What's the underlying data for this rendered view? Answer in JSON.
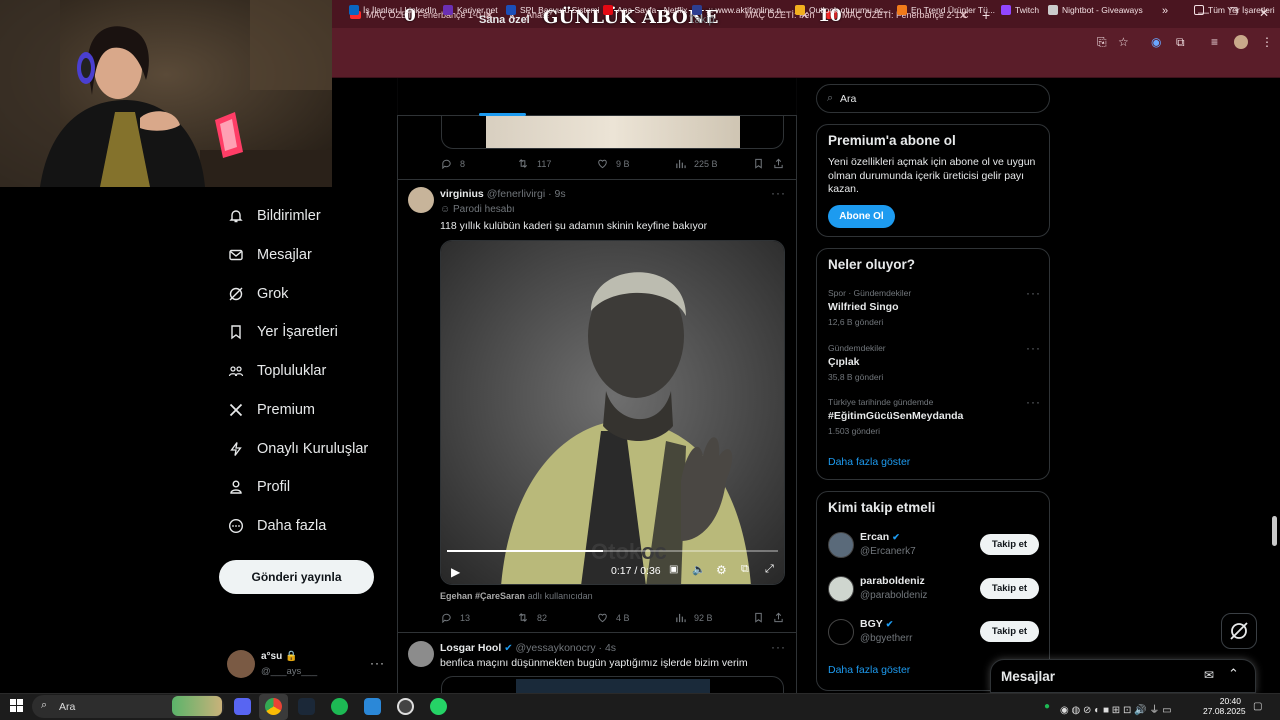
{
  "browser": {
    "tabs": [
      {
        "title": "MAÇ ÖZETİ Fenerbahçe 1-0 In",
        "color": "#ff2a2a"
      },
      {
        "title": "Anasa",
        "color": "#000000"
      },
      {
        "title": "MAÇ ÖZETİ: Fenerbahçe 3-0 M",
        "color": "#ff2a2a"
      },
      {
        "title": "MAÇ ÖZETİ: Fenerbahçe 2-1 C",
        "color": "#ff2a2a"
      }
    ],
    "new_tab": "+",
    "overlay": {
      "left_count": "0",
      "title": "GÜNLÜK ABONE",
      "right_count": "10"
    },
    "bookmarks": [
      {
        "label": "İş İlanları | LinkedIn",
        "color": "#0a66c2"
      },
      {
        "label": "Kariyer.net",
        "color": "#6b2fb3"
      },
      {
        "label": "SPL Başvuru Sistemi",
        "color": "#1b4fb8"
      },
      {
        "label": "Ana Sayfa - Netflix",
        "color": "#e50914"
      },
      {
        "label": ".:: www.aktifonline.n...",
        "color": "#2c3e90"
      },
      {
        "label": "Outlook oturumu aç...",
        "color": "#f2b01e"
      },
      {
        "label": "En Trend Ürünler Tü...",
        "color": "#f27a1a"
      },
      {
        "label": "Twitch",
        "color": "#9146ff"
      },
      {
        "label": "Nightbot - Giveaways",
        "color": "#cccccc"
      }
    ],
    "bookmarks_more": "»",
    "all_bookmarks": "Tüm Yer İşaretleri"
  },
  "sidebar": {
    "items": [
      {
        "label": "Bildirimler",
        "icon": "bell-icon"
      },
      {
        "label": "Mesajlar",
        "icon": "envelope-icon"
      },
      {
        "label": "Grok",
        "icon": "grok-icon"
      },
      {
        "label": "Yer İşaretleri",
        "icon": "bookmark-icon"
      },
      {
        "label": "Topluluklar",
        "icon": "communities-icon"
      },
      {
        "label": "Premium",
        "icon": "x-logo-icon"
      },
      {
        "label": "Onaylı Kuruluşlar",
        "icon": "lightning-icon"
      },
      {
        "label": "Profil",
        "icon": "person-icon"
      },
      {
        "label": "Daha fazla",
        "icon": "more-circle-icon"
      }
    ],
    "post_button": "Gönderi yayınla",
    "account": {
      "name": "a°su",
      "handle": "@___ays___"
    }
  },
  "timeline": {
    "tabs": [
      "Sana özel",
      "Takip"
    ],
    "prev_post_stats": {
      "replies": "8",
      "reposts": "117",
      "likes": "9 B",
      "views": "225 B"
    },
    "post1": {
      "name": "virginius",
      "handle": "@fenerlivirgi",
      "time": "· 9s",
      "label": "Parodi hesabı",
      "text": "118 yıllık kulübün kaderi şu adamın skinin keyfine bakıyor",
      "video_time": "0:17 / 0:36",
      "video_progress": 0.47,
      "caption_user": "Egehan #ÇareSaran",
      "caption_suffix": "adlı kullanıcıdan",
      "stats": {
        "replies": "13",
        "reposts": "82",
        "likes": "4 B",
        "views": "92 B"
      }
    },
    "post2": {
      "name": "Losgar Hool",
      "handle": "@yessaykonocry",
      "time": "· 4s",
      "text": "benfica maçını düşünmekten bugün yaptığımız işlerde bizim verim"
    }
  },
  "right": {
    "search_placeholder": "Ara",
    "premium": {
      "title": "Premium'a abone ol",
      "text": "Yeni özellikleri açmak için abone ol ve uygun olman durumunda içerik üreticisi gelir payı kazan.",
      "button": "Abone Ol"
    },
    "trends_title": "Neler oluyor?",
    "trends": [
      {
        "meta": "Spor · Gündemdekiler",
        "name": "Wilfried Singo",
        "count": "12,6 B gönderi"
      },
      {
        "meta": "Gündemdekiler",
        "name": "Çıplak",
        "count": "35,8 B gönderi"
      },
      {
        "meta": "Türkiye tarihinde gündemde",
        "name": "#EğitimGücüSenMeydanda",
        "count": "1.503 gönderi"
      }
    ],
    "show_more": "Daha fazla göster",
    "who_to_follow_title": "Kimi takip etmeli",
    "follow": [
      {
        "name": "Ercan",
        "handle": "@Ercanerk7",
        "verified": true
      },
      {
        "name": "paraboldeniz",
        "handle": "@paraboldeniz",
        "verified": false
      },
      {
        "name": "BGY",
        "handle": "@bgyetherr",
        "verified": true
      }
    ],
    "follow_button": "Takip et",
    "show_more2": "Daha fazla göster",
    "messages_drawer": "Mesajlar"
  },
  "taskbar": {
    "search": "Ara",
    "time": "20:40",
    "date": "27.08.2025"
  },
  "colors": {
    "accent": "#1d9bf0",
    "browser_frame": "#5a1d29",
    "tab_strip": "#4a1520"
  }
}
